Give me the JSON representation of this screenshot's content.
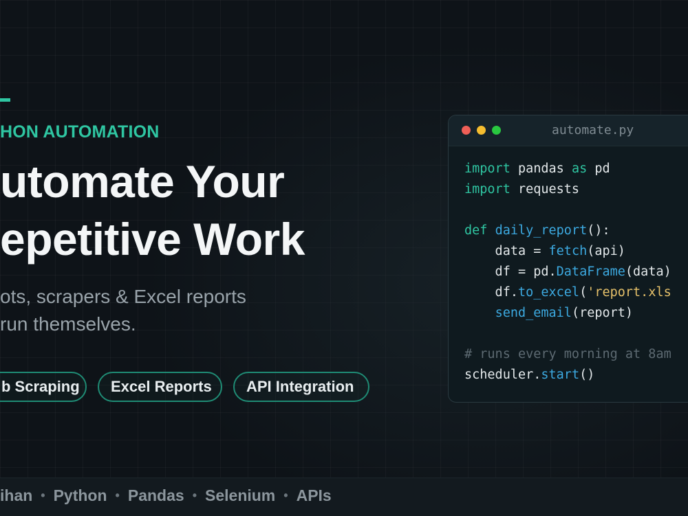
{
  "hero": {
    "eyebrow": "HON AUTOMATION",
    "headline_line1": "utomate Your",
    "headline_line2": "epetitive Work",
    "subtitle_line1": "ots, scrapers & Excel reports",
    "subtitle_line2": "run themselves."
  },
  "tags": [
    {
      "label": "b Scraping"
    },
    {
      "label": "Excel Reports"
    },
    {
      "label": "API Integration"
    }
  ],
  "footer": {
    "items": [
      "ihan",
      "Python",
      "Pandas",
      "Selenium",
      "APIs"
    ],
    "separator": "•"
  },
  "code_window": {
    "filename": "automate.py",
    "lines": [
      {
        "parts": [
          {
            "t": "kw",
            "v": "import"
          },
          {
            "t": "",
            "v": " pandas "
          },
          {
            "t": "kw",
            "v": "as"
          },
          {
            "t": "",
            "v": " pd"
          }
        ]
      },
      {
        "parts": [
          {
            "t": "kw",
            "v": "import"
          },
          {
            "t": "",
            "v": " requests"
          }
        ]
      },
      {
        "parts": []
      },
      {
        "parts": [
          {
            "t": "kw",
            "v": "def"
          },
          {
            "t": "",
            "v": " "
          },
          {
            "t": "fn",
            "v": "daily_report"
          },
          {
            "t": "",
            "v": "():"
          }
        ]
      },
      {
        "parts": [
          {
            "t": "",
            "v": "    data = "
          },
          {
            "t": "fn",
            "v": "fetch"
          },
          {
            "t": "",
            "v": "(api)"
          }
        ]
      },
      {
        "parts": [
          {
            "t": "",
            "v": "    df = pd."
          },
          {
            "t": "fn",
            "v": "DataFrame"
          },
          {
            "t": "",
            "v": "(data)"
          }
        ]
      },
      {
        "parts": [
          {
            "t": "",
            "v": "    df."
          },
          {
            "t": "fn",
            "v": "to_excel"
          },
          {
            "t": "",
            "v": "("
          },
          {
            "t": "str",
            "v": "'report.xls"
          }
        ]
      },
      {
        "parts": [
          {
            "t": "",
            "v": "    "
          },
          {
            "t": "fn",
            "v": "send_email"
          },
          {
            "t": "",
            "v": "(report)"
          }
        ]
      },
      {
        "parts": []
      },
      {
        "parts": [
          {
            "t": "cm",
            "v": "# runs every morning at 8am"
          }
        ]
      },
      {
        "parts": [
          {
            "t": "",
            "v": "scheduler."
          },
          {
            "t": "fn",
            "v": "start"
          },
          {
            "t": "",
            "v": "()"
          }
        ]
      }
    ]
  },
  "colors": {
    "accent": "#2fc6a2",
    "background": "#0e1318",
    "keyword": "#2fc6a2",
    "function": "#3ca9e0",
    "string": "#e6c16a",
    "comment": "#5d6a72"
  }
}
